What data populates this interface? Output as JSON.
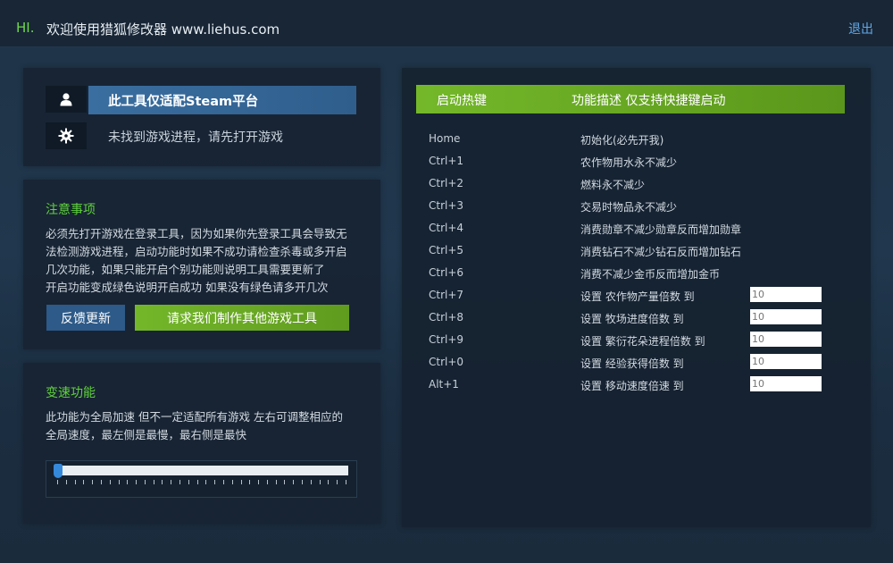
{
  "titlebar": {
    "greeting": "HI.",
    "title": "欢迎使用猎狐修改器 www.liehus.com",
    "logout": "退出"
  },
  "status": {
    "platform": "此工具仅适配Steam平台",
    "process_message": "未找到游戏进程，请先打开游戏",
    "icons": [
      "user-icon",
      "gear-icon"
    ]
  },
  "notes": {
    "title": "注意事项",
    "lines": [
      "必须先打开游戏在登录工具，因为如果你先登录工具会导致无",
      "法检测游戏进程，启动功能时如果不成功请检查杀毒或多开启",
      "几次功能，如果只能开启个别功能则说明工具需要更新了",
      "开启功能变成绿色说明开启成功 如果没有绿色请多开几次"
    ],
    "feedback_button": "反馈更新",
    "request_button": "请求我们制作其他游戏工具"
  },
  "speed": {
    "title": "变速功能",
    "lines": [
      "此功能为全局加速 但不一定适配所有游戏 左右可调整相应的",
      "全局速度，最左侧是最慢，最右侧是最快"
    ],
    "slider_value": 0
  },
  "hotkeys": {
    "header_key": "启动热键",
    "header_desc": "功能描述 仅支持快捷键启动",
    "rows": [
      {
        "key": "Home",
        "desc": "初始化(必先开我)"
      },
      {
        "key": "Ctrl+1",
        "desc": "农作物用水永不减少"
      },
      {
        "key": "Ctrl+2",
        "desc": "燃料永不减少"
      },
      {
        "key": "Ctrl+3",
        "desc": "交易时物品永不减少"
      },
      {
        "key": "Ctrl+4",
        "desc": "消费勋章不减少勋章反而增加勋章"
      },
      {
        "key": "Ctrl+5",
        "desc": "消费钻石不减少钻石反而增加钻石"
      },
      {
        "key": "Ctrl+6",
        "desc": "消费不减少金币反而增加金币"
      },
      {
        "key": "Ctrl+7",
        "desc": "设置 农作物产量倍数 到",
        "input": "10"
      },
      {
        "key": "Ctrl+8",
        "desc": "设置 牧场进度倍数 到",
        "input": "10"
      },
      {
        "key": "Ctrl+9",
        "desc": "设置 繁衍花朵进程倍数 到",
        "input": "10"
      },
      {
        "key": "Ctrl+0",
        "desc": "设置 经验获得倍数 到",
        "input": "10"
      },
      {
        "key": "Alt+1",
        "desc": "设置 移动速度倍速 到",
        "input": "10"
      }
    ]
  }
}
